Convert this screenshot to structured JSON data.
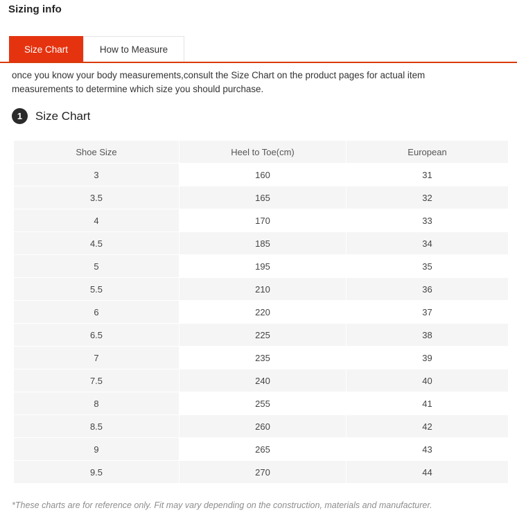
{
  "panel": {
    "title": "Sizing info"
  },
  "tabs": [
    {
      "label": "Size Chart",
      "state": "active"
    },
    {
      "label": "How to Measure",
      "state": "inactive"
    }
  ],
  "description": "once you know your body measurements,consult the Size Chart on the product pages for actual item measurements to determine which size you should purchase.",
  "section": {
    "badge": "1",
    "title": "Size Chart"
  },
  "chart_data": {
    "type": "table",
    "title": "Size Chart",
    "columns": [
      "Shoe Size",
      "Heel to Toe(cm)",
      "European"
    ],
    "rows": [
      [
        "3",
        "160",
        "31"
      ],
      [
        "3.5",
        "165",
        "32"
      ],
      [
        "4",
        "170",
        "33"
      ],
      [
        "4.5",
        "185",
        "34"
      ],
      [
        "5",
        "195",
        "35"
      ],
      [
        "5.5",
        "210",
        "36"
      ],
      [
        "6",
        "220",
        "37"
      ],
      [
        "6.5",
        "225",
        "38"
      ],
      [
        "7",
        "235",
        "39"
      ],
      [
        "7.5",
        "240",
        "40"
      ],
      [
        "8",
        "255",
        "41"
      ],
      [
        "8.5",
        "260",
        "42"
      ],
      [
        "9",
        "265",
        "43"
      ],
      [
        "9.5",
        "270",
        "44"
      ]
    ]
  },
  "footnote": "*These charts are for reference only. Fit may vary depending on the construction, materials and manufacturer.",
  "colors": {
    "accent": "#e5330f",
    "accent_rule": "#d93b0b",
    "badge": "#2b2b2b",
    "row_tint": "#f5f5f5",
    "footnote_text": "#8d8d8d"
  }
}
